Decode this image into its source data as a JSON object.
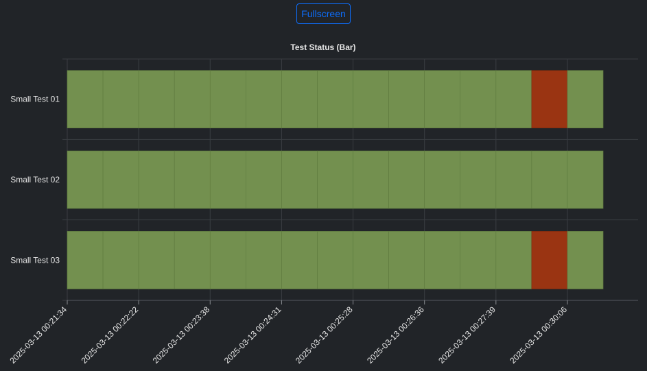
{
  "toolbar": {
    "fullscreen_label": "Fullscreen"
  },
  "chart_data": {
    "type": "bar",
    "title": "Test Status (Bar)",
    "xlabel": "",
    "ylabel": "",
    "categories": [
      "Small Test 01",
      "Small Test 02",
      "Small Test 03"
    ],
    "x_tick_labels": [
      "2025-03-13 00:21:34",
      "2025-03-13 00:22:22",
      "2025-03-13 00:23:38",
      "2025-03-13 00:24:31",
      "2025-03-13 00:25:28",
      "2025-03-13 00:26:36",
      "2025-03-13 00:27:39",
      "2025-03-13 00:30:06"
    ],
    "segment_count": 15,
    "status_colors": {
      "pass": "#73904f",
      "fail": "#9a3412"
    },
    "series": [
      {
        "category": "Small Test 01",
        "statuses": [
          "pass",
          "pass",
          "pass",
          "pass",
          "pass",
          "pass",
          "pass",
          "pass",
          "pass",
          "pass",
          "pass",
          "pass",
          "pass",
          "fail",
          "pass"
        ]
      },
      {
        "category": "Small Test 02",
        "statuses": [
          "pass",
          "pass",
          "pass",
          "pass",
          "pass",
          "pass",
          "pass",
          "pass",
          "pass",
          "pass",
          "pass",
          "pass",
          "pass",
          "pass",
          "pass"
        ]
      },
      {
        "category": "Small Test 03",
        "statuses": [
          "pass",
          "pass",
          "pass",
          "pass",
          "pass",
          "pass",
          "pass",
          "pass",
          "pass",
          "pass",
          "pass",
          "pass",
          "pass",
          "fail",
          "pass"
        ]
      }
    ],
    "grid": true,
    "legend": "none"
  }
}
